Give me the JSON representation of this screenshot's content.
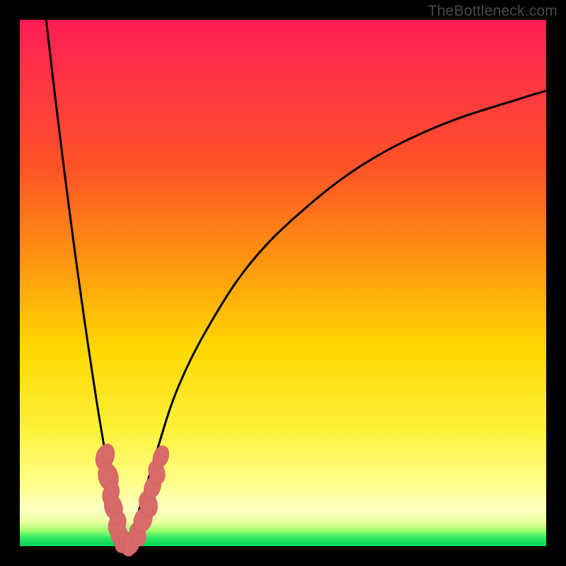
{
  "watermark": "TheBottleneck.com",
  "colors": {
    "frame": "#000000",
    "curve_stroke": "#000000",
    "dot_fill": "#d86a6a",
    "dot_stroke": "#c95a5a"
  },
  "chart_data": {
    "type": "line",
    "title": "",
    "xlabel": "",
    "ylabel": "",
    "xlim": [
      0,
      100
    ],
    "ylim": [
      0,
      100
    ],
    "grid": false,
    "legend": false,
    "series": [
      {
        "name": "left-branch",
        "x": [
          5,
          7,
          9,
          11,
          13,
          15,
          17,
          18,
          19,
          19.5,
          20
        ],
        "y": [
          100,
          83,
          67,
          52,
          38,
          25,
          13,
          7,
          3,
          1,
          0
        ]
      },
      {
        "name": "right-branch",
        "x": [
          20,
          21,
          23,
          26,
          30,
          36,
          44,
          54,
          66,
          80,
          95,
          100
        ],
        "y": [
          0,
          2,
          8,
          18,
          30,
          42,
          54,
          64,
          73,
          80,
          85,
          86.5
        ]
      }
    ],
    "markers": [
      {
        "x": 16.2,
        "y": 17.0,
        "r": 2.0
      },
      {
        "x": 16.8,
        "y": 13.2,
        "r": 2.2
      },
      {
        "x": 17.3,
        "y": 10.0,
        "r": 1.8
      },
      {
        "x": 17.8,
        "y": 7.4,
        "r": 2.0
      },
      {
        "x": 18.5,
        "y": 4.2,
        "r": 1.9
      },
      {
        "x": 19.0,
        "y": 2.0,
        "r": 1.9
      },
      {
        "x": 19.6,
        "y": 0.8,
        "r": 1.7
      },
      {
        "x": 20.4,
        "y": 0.3,
        "r": 1.8
      },
      {
        "x": 21.2,
        "y": 0.5,
        "r": 1.8
      },
      {
        "x": 22.4,
        "y": 2.2,
        "r": 1.8
      },
      {
        "x": 23.4,
        "y": 5.0,
        "r": 2.0
      },
      {
        "x": 24.4,
        "y": 8.0,
        "r": 2.0
      },
      {
        "x": 25.2,
        "y": 11.2,
        "r": 1.8
      },
      {
        "x": 26.0,
        "y": 14.0,
        "r": 1.8
      },
      {
        "x": 26.8,
        "y": 17.0,
        "r": 1.7
      }
    ]
  }
}
